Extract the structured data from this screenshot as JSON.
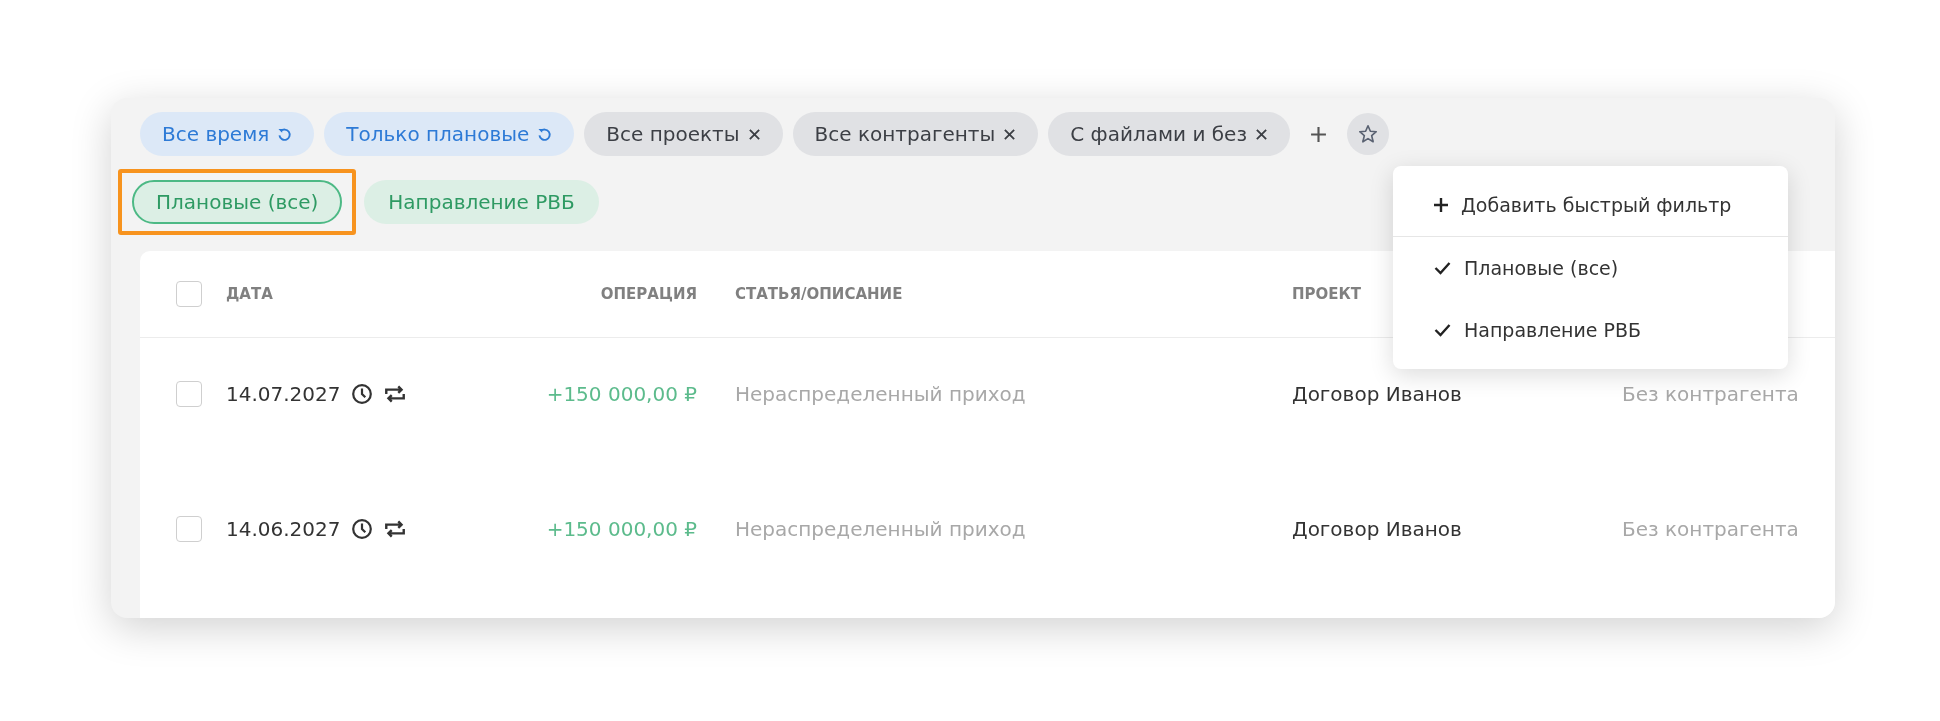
{
  "filters": [
    {
      "label": "Все время",
      "kind": "reset"
    },
    {
      "label": "Только плановые",
      "kind": "reset"
    },
    {
      "label": "Все проекты",
      "kind": "remove"
    },
    {
      "label": "Все контрагенты",
      "kind": "remove"
    },
    {
      "label": "С файлами и без",
      "kind": "remove"
    }
  ],
  "quick_filters": [
    {
      "label": "Плановые (все)",
      "selected": true,
      "highlighted": true
    },
    {
      "label": "Направление РВБ",
      "selected": false,
      "highlighted": false
    }
  ],
  "menu": [
    {
      "kind": "add",
      "label": "Добавить быстрый фильтр"
    },
    {
      "kind": "check",
      "label": "Плановые (все)",
      "checked": true
    },
    {
      "kind": "check",
      "label": "Направление РВБ",
      "checked": true
    }
  ],
  "table": {
    "header_checked": false,
    "columns": [
      "ДАТА",
      "ОПЕРАЦИЯ",
      "СТАТЬЯ/ОПИСАНИЕ",
      "ПРОЕКТ"
    ],
    "rows": [
      {
        "checked": false,
        "date": "14.07.2027",
        "amount": "+150 000,00 ₽",
        "description": "Нераспределенный приход",
        "project": "Договор Иванов",
        "counterparty": "Без контрагента"
      },
      {
        "checked": false,
        "date": "14.06.2027",
        "amount": "+150 000,00 ₽",
        "description": "Нераспределенный приход",
        "project": "Договор Иванов",
        "counterparty": "Без контрагента"
      }
    ]
  }
}
